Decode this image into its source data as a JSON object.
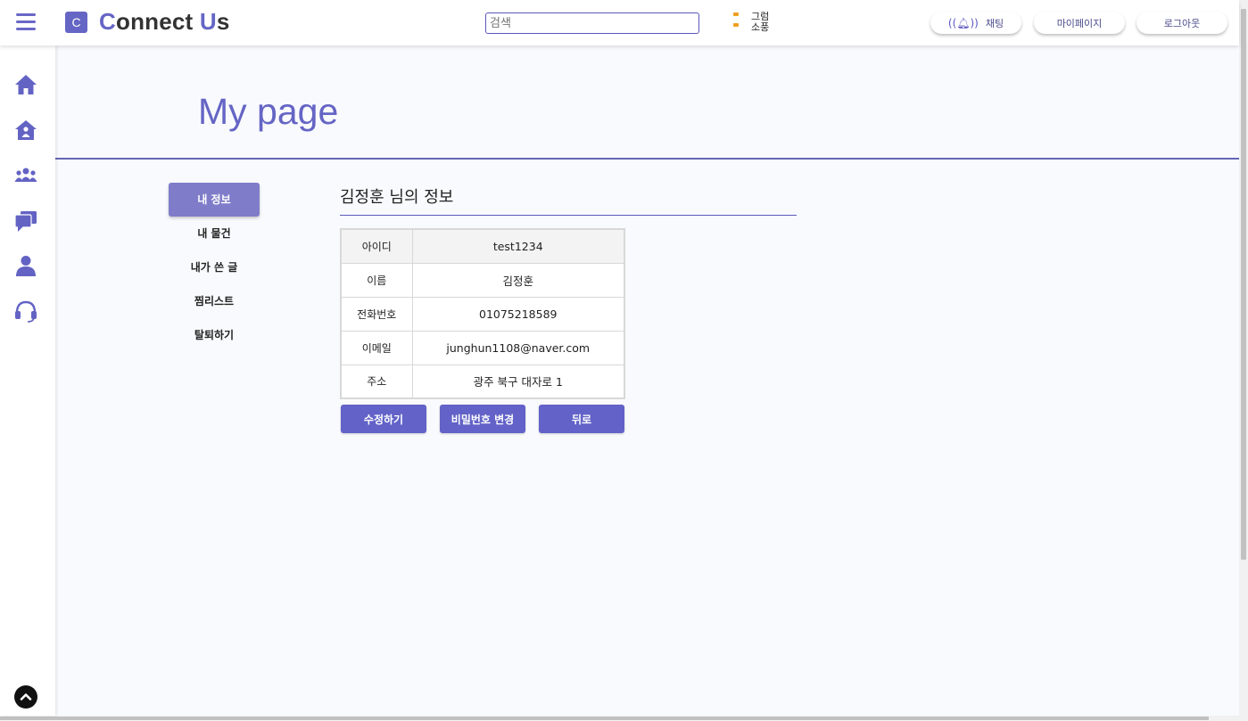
{
  "header": {
    "logo_letter": "C",
    "logo_first_letter": "C",
    "logo_mid": "onnect ",
    "logo_accent": "U",
    "logo_end": "s",
    "search_placeholder": "검색",
    "weather_line1": "그럼",
    "weather_line2": "소풍",
    "buttons": {
      "chat": "채팅",
      "mypage": "마이페이지",
      "logout": "로그아웃"
    }
  },
  "sidebar": {
    "icons": [
      "home-icon",
      "house-person-icon",
      "community-icon",
      "chat-bubbles-icon",
      "user-icon",
      "headset-icon"
    ],
    "scroll_top_icon": "chevron-up-icon"
  },
  "page": {
    "title": "My page"
  },
  "menu": {
    "items": [
      {
        "label": "내 정보",
        "active": true
      },
      {
        "label": "내 물건",
        "active": false
      },
      {
        "label": "내가 쓴 글",
        "active": false
      },
      {
        "label": "찜리스트",
        "active": false
      },
      {
        "label": "탈퇴하기",
        "active": false
      }
    ]
  },
  "info": {
    "title": "김정훈 님의 정보",
    "rows": [
      {
        "key": "아이디",
        "value": "test1234"
      },
      {
        "key": "이름",
        "value": "김정훈"
      },
      {
        "key": "전화번호",
        "value": "01075218589"
      },
      {
        "key": "이메일",
        "value": "junghun1108@naver.com"
      },
      {
        "key": "주소",
        "value": "광주 북구 대자로 1"
      }
    ]
  },
  "actions": {
    "edit": "수정하기",
    "change_password": "비밀번호 변경",
    "back": "뒤로"
  },
  "colors": {
    "accent": "#6565c5",
    "active_menu": "#7f7dc9",
    "button": "#6262c8"
  }
}
